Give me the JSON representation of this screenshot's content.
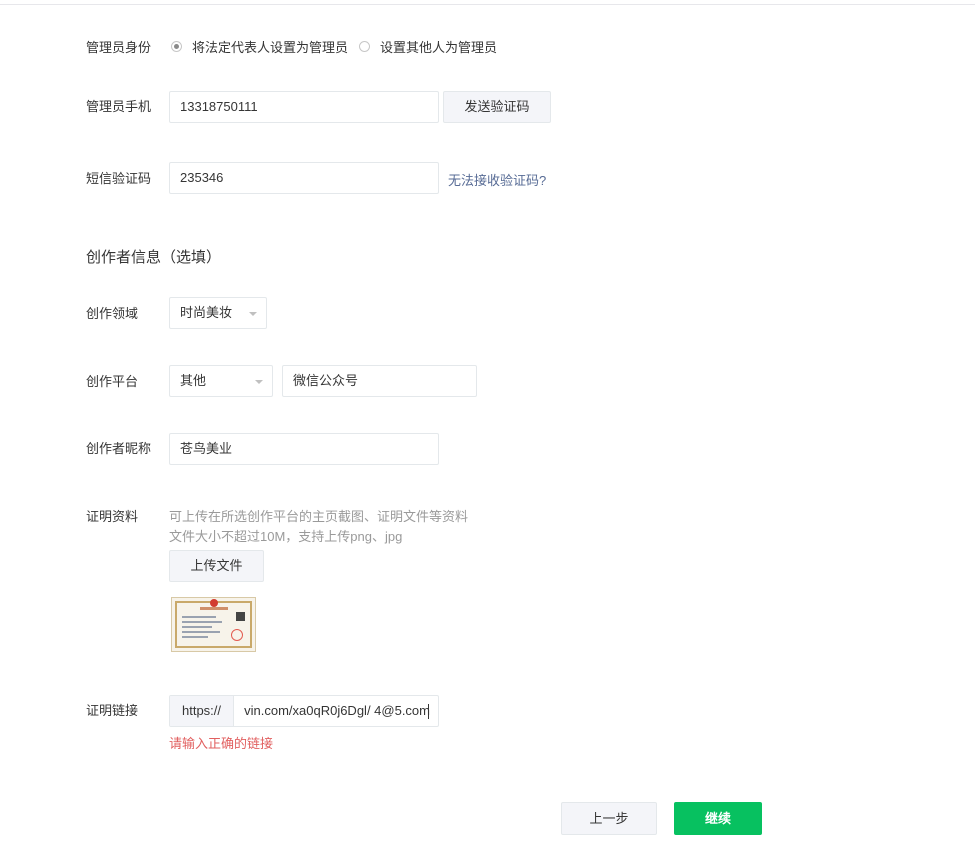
{
  "admin_identity": {
    "label": "管理员身份",
    "options": [
      {
        "label": "将法定代表人设置为管理员",
        "checked": true
      },
      {
        "label": "设置其他人为管理员",
        "checked": false
      }
    ]
  },
  "admin_phone": {
    "label": "管理员手机",
    "value": "13318750111",
    "send_code_label": "发送验证码"
  },
  "sms_code": {
    "label": "短信验证码",
    "value": "235346",
    "help_link": "无法接收验证码?"
  },
  "creator_section": {
    "title": "创作者信息（选填）"
  },
  "field": {
    "label": "创作领域",
    "value": "时尚美妆"
  },
  "platform": {
    "label": "创作平台",
    "value": "其他",
    "custom_value": "微信公众号"
  },
  "nickname": {
    "label": "创作者昵称",
    "value": "苍鸟美业"
  },
  "proof": {
    "label": "证明资料",
    "hint_line1": "可上传在所选创作平台的主页截图、证明文件等资料",
    "hint_line2": "文件大小不超过10M，支持上传png、jpg",
    "upload_label": "上传文件"
  },
  "proof_link": {
    "label": "证明链接",
    "prefix": "https://",
    "value": "vin.com/xa0qR0j6Dgl/ 4@5.com",
    "error": "请输入正确的链接"
  },
  "footer": {
    "prev_label": "上一步",
    "continue_label": "继续"
  },
  "colors": {
    "accent_green": "#07c160",
    "link_blue": "#576b95",
    "error_red": "#e15f5f"
  }
}
